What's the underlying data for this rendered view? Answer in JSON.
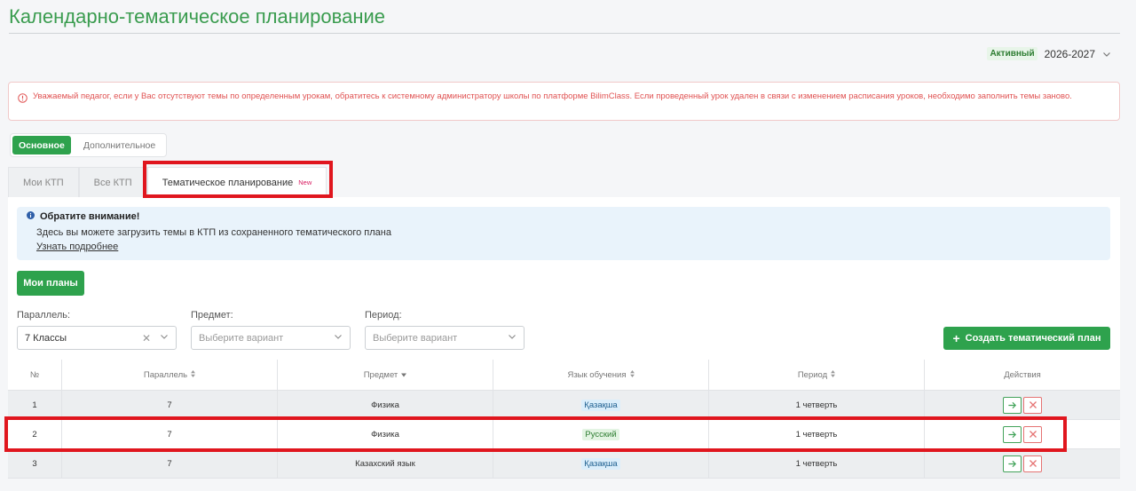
{
  "page": {
    "title": "Календарно-тематическое планирование"
  },
  "year": {
    "status": "Активный",
    "value": "2026-2027"
  },
  "alert": {
    "text": "Уважаемый педагог, если у Вас отсутствуют темы по определенным урокам, обратитесь к системному администратору школы по платформе BilimClass. Если проведенный урок удален в связи с изменением расписания уроков, необходимо заполнить темы заново."
  },
  "segment": {
    "primary": "Основное",
    "secondary": "Дополнительное"
  },
  "tabs": [
    {
      "label": "Мои КТП"
    },
    {
      "label": "Все КТП"
    },
    {
      "label": "Тематическое планирование",
      "badge": "New"
    }
  ],
  "info": {
    "title": "Обратите внимание!",
    "text": "Здесь вы можете загрузить темы в КТП из сохраненного тематического плана",
    "link": "Узнать подробнее"
  },
  "buttons": {
    "my_plans": "Мои планы",
    "create_plan": "Создать тематический план"
  },
  "filters": {
    "parallel": {
      "label": "Параллель:",
      "value": "7 Классы"
    },
    "subject": {
      "label": "Предмет:",
      "placeholder": "Выберите вариант"
    },
    "period": {
      "label": "Период:",
      "placeholder": "Выберите вариант"
    }
  },
  "table": {
    "headers": [
      "№",
      "Параллель",
      "Предмет",
      "Язык обучения",
      "Период",
      "Действия"
    ],
    "rows": [
      {
        "num": "1",
        "parallel": "7",
        "subject": "Физика",
        "language": "Қазақша",
        "period": "1 четверть"
      },
      {
        "num": "2",
        "parallel": "7",
        "subject": "Физика",
        "language": "Русский",
        "period": "1 четверть"
      },
      {
        "num": "3",
        "parallel": "7",
        "subject": "Казахский язык",
        "language": "Қазақша",
        "period": "1 четверть"
      }
    ]
  },
  "colors": {
    "accent": "#2ea24d",
    "highlight": "#e0161e",
    "alert": "#e05252"
  }
}
